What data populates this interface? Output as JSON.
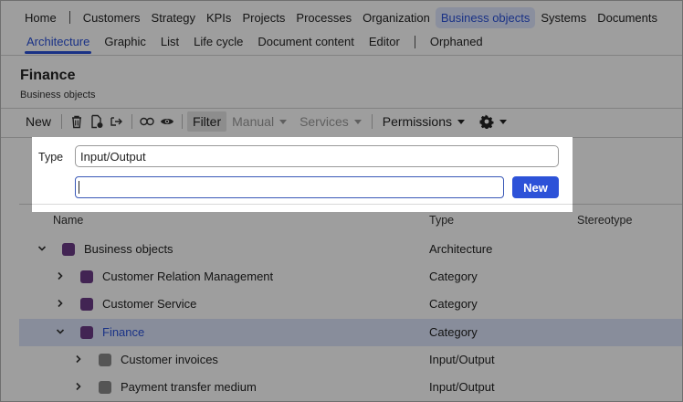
{
  "top_nav": {
    "items": [
      "Home",
      "Customers",
      "Strategy",
      "KPIs",
      "Projects",
      "Processes",
      "Organization",
      "Business objects",
      "Systems",
      "Documents"
    ],
    "active": "Business objects"
  },
  "sub_nav": {
    "items": [
      "Architecture",
      "Graphic",
      "List",
      "Life cycle",
      "Document content",
      "Editor",
      "Orphaned"
    ],
    "active": "Architecture"
  },
  "page": {
    "title": "Finance",
    "subtitle": "Business objects"
  },
  "toolbar": {
    "new_label": "New",
    "icons": [
      "trash-icon",
      "gear-document-icon",
      "move-icon",
      "link-icon",
      "eye-icon"
    ],
    "filter_label": "Filter",
    "manual_label": "Manual",
    "services_label": "Services",
    "permissions_label": "Permissions",
    "settings_icon": "gear-icon"
  },
  "popup": {
    "type_label": "Type",
    "type_value": "Input/Output",
    "name_value": "",
    "new_button": "New"
  },
  "table": {
    "columns": [
      "Name",
      "Type",
      "Stereotype"
    ],
    "rows": [
      {
        "name": "Business objects",
        "type": "Architecture",
        "level": 0,
        "expanded": true,
        "color": "#6b3a86",
        "selected": false
      },
      {
        "name": "Customer Relation Management",
        "type": "Category",
        "level": 1,
        "expanded": false,
        "color": "#6b3a86",
        "selected": false
      },
      {
        "name": "Customer Service",
        "type": "Category",
        "level": 1,
        "expanded": false,
        "color": "#6b3a86",
        "selected": false
      },
      {
        "name": "Finance",
        "type": "Category",
        "level": 1,
        "expanded": true,
        "color": "#6b3a86",
        "selected": true
      },
      {
        "name": "Customer invoices",
        "type": "Input/Output",
        "level": 2,
        "expanded": false,
        "color": "#8a8a8a",
        "selected": false
      },
      {
        "name": "Payment transfer medium",
        "type": "Input/Output",
        "level": 2,
        "expanded": false,
        "color": "#8a8a8a",
        "selected": false
      }
    ]
  },
  "colors": {
    "accent": "#2a51d8",
    "selected_row": "#dbe4fb",
    "category_square": "#6b3a86",
    "io_square": "#8a8a8a"
  }
}
